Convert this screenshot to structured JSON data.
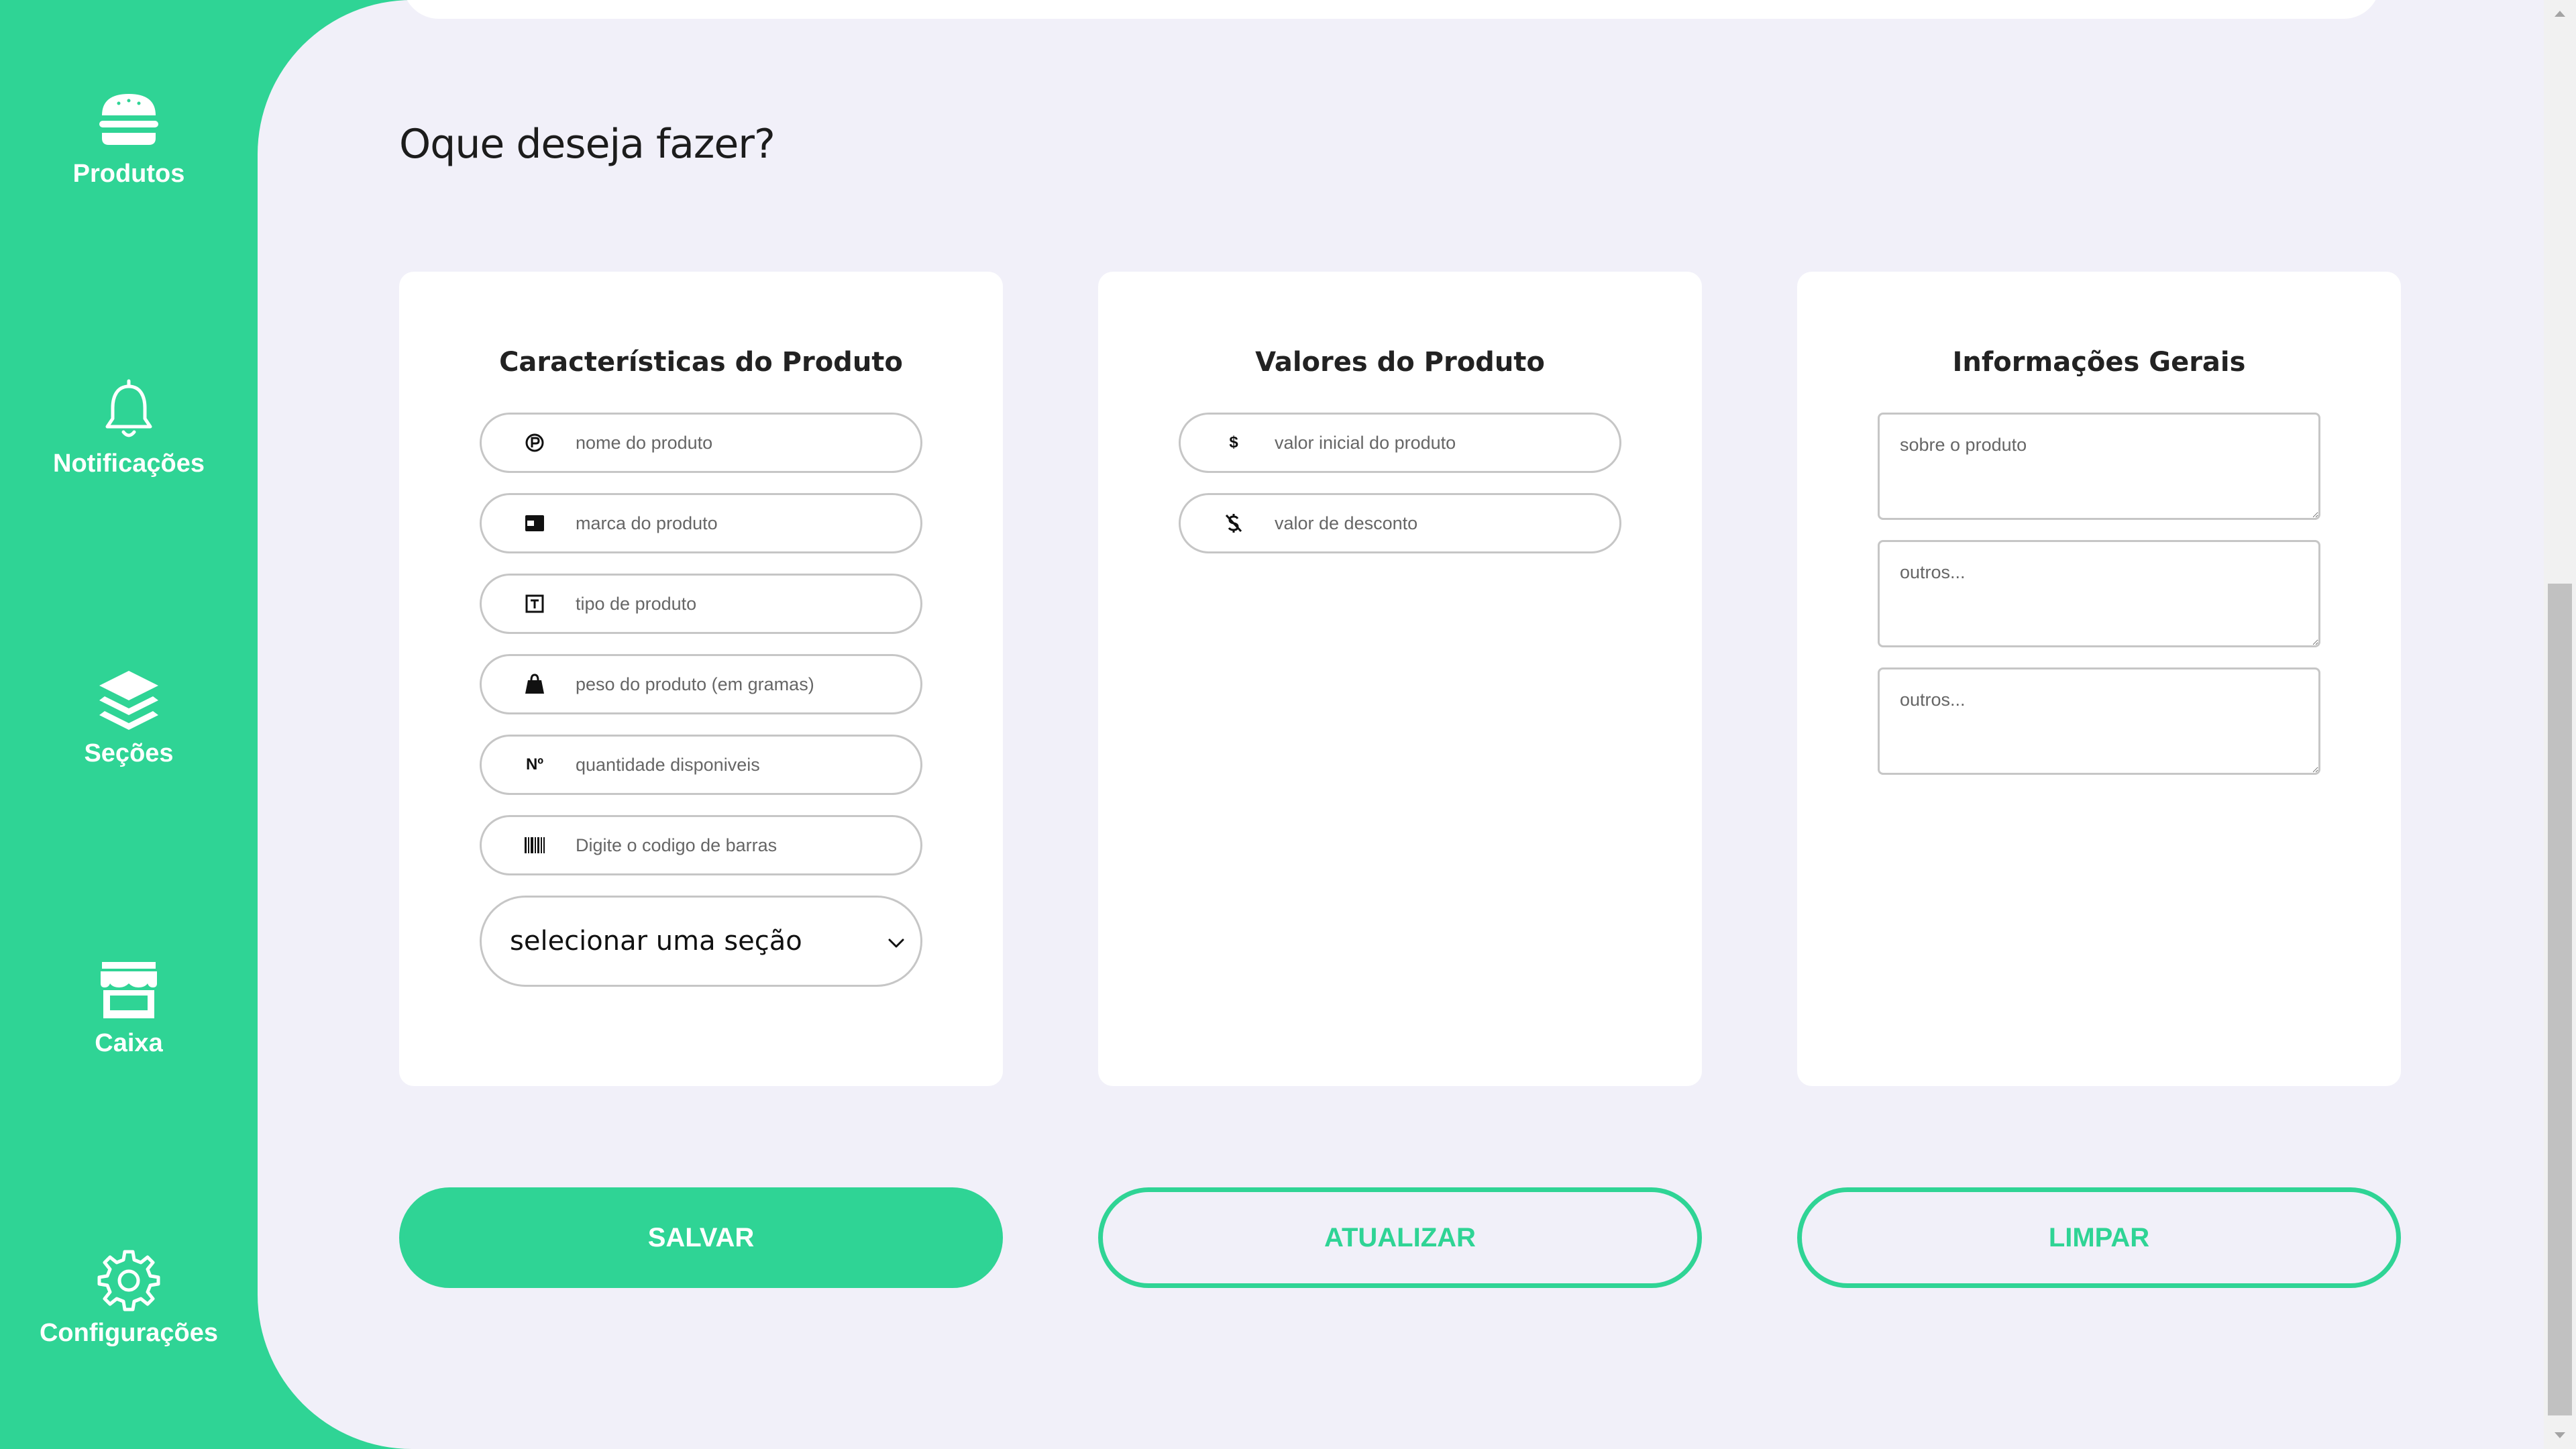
{
  "sidebar": {
    "items": [
      {
        "label": "Produtos",
        "icon": "burger-icon"
      },
      {
        "label": "Notificações",
        "icon": "bell-icon"
      },
      {
        "label": "Seções",
        "icon": "layers-icon"
      },
      {
        "label": "Caixa",
        "icon": "store-icon"
      },
      {
        "label": "Configurações",
        "icon": "gear-icon"
      }
    ]
  },
  "main": {
    "title": "Oque deseja fazer?",
    "cards": {
      "product": {
        "title": "Características do Produto",
        "fields": {
          "name": {
            "placeholder": "nome do produto",
            "icon": "product-name-icon"
          },
          "brand": {
            "placeholder": "marca do produto",
            "icon": "brand-icon"
          },
          "type": {
            "placeholder": "tipo de produto",
            "icon": "text-type-icon"
          },
          "weight": {
            "placeholder": "peso do produto (em gramas)",
            "icon": "weight-bag-icon"
          },
          "quantity": {
            "placeholder": "quantidade disponiveis",
            "icon": "numero-icon",
            "glyph": "Nº"
          },
          "barcode": {
            "placeholder": "Digite o codigo de barras",
            "icon": "barcode-icon"
          }
        },
        "section_select": {
          "value": "selecionar uma seção"
        }
      },
      "values": {
        "title": "Valores do Produto",
        "fields": {
          "initial": {
            "placeholder": "valor inicial do produto",
            "icon": "dollar-icon",
            "glyph": "$"
          },
          "discount": {
            "placeholder": "valor de desconto",
            "icon": "dollar-off-icon"
          }
        }
      },
      "info": {
        "title": "Informações Gerais",
        "textareas": {
          "about": {
            "placeholder": "sobre o produto"
          },
          "other1": {
            "placeholder": "outros..."
          },
          "other2": {
            "placeholder": "outros..."
          }
        }
      }
    },
    "buttons": {
      "save": "SALVAR",
      "update": "ATUALIZAR",
      "clear": "LIMPAR"
    }
  },
  "colors": {
    "accent": "#2fd495",
    "background": "#f1f0f9",
    "card": "#ffffff"
  }
}
